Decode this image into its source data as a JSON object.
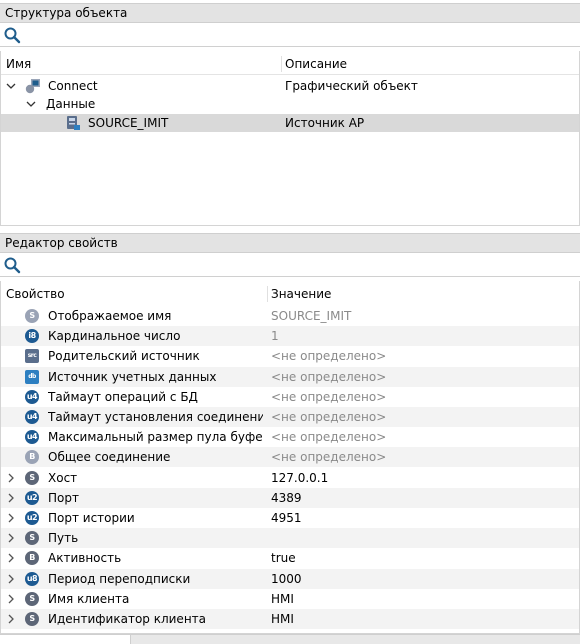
{
  "structure_panel": {
    "title": "Структура объекта",
    "search": {
      "value": "",
      "placeholder": "",
      "icon": "search-icon"
    },
    "columns": {
      "name": "Имя",
      "description": "Описание"
    },
    "tree": [
      {
        "label": "Connect",
        "description": "Графический объект",
        "icon": "graphic-object-icon",
        "expanded": true
      },
      {
        "label": "Данные",
        "description": "",
        "expanded": true
      },
      {
        "label": "SOURCE_IMIT",
        "description": "Источник АР",
        "icon": "data-source-icon",
        "selected": true
      }
    ]
  },
  "properties_panel": {
    "title": "Редактор свойств",
    "search": {
      "value": "",
      "placeholder": "",
      "icon": "search-icon"
    },
    "columns": {
      "property": "Свойство",
      "value": "Значение"
    },
    "rows": [
      {
        "badge": "S",
        "badge_color": "#9aa3b5",
        "name": "Отображаемое имя",
        "value": "SOURCE_IMIT",
        "muted": true,
        "expandable": false
      },
      {
        "badge": "i8",
        "badge_color": "#1d5a92",
        "name": "Кардинальное число",
        "value": "1",
        "muted": true,
        "expandable": false
      },
      {
        "badge": "src",
        "badge_color": "#5a6e8c",
        "name": "Родительский источник",
        "value": "<не определено>",
        "muted": true,
        "expandable": false
      },
      {
        "badge": "db",
        "badge_color": "#2d7fc1",
        "name": "Источник учетных данных",
        "value": "<не определено>",
        "muted": true,
        "expandable": false
      },
      {
        "badge": "u4",
        "badge_color": "#1d5a92",
        "name": "Таймаут операций с БД",
        "value": "<не определено>",
        "muted": true,
        "expandable": false
      },
      {
        "badge": "u4",
        "badge_color": "#1d5a92",
        "name": "Таймаут установления соединения с ...",
        "value": "<не определено>",
        "muted": true,
        "expandable": false
      },
      {
        "badge": "u4",
        "badge_color": "#1d5a92",
        "name": "Максимальный размер пула буферов",
        "value": "<не определено>",
        "muted": true,
        "expandable": false
      },
      {
        "badge": "B",
        "badge_color": "#9aa3b5",
        "name": "Общее соединение",
        "value": "<не определено>",
        "muted": true,
        "expandable": false
      },
      {
        "badge": "S",
        "badge_color": "#5d6677",
        "name": "Хост",
        "value": "127.0.0.1",
        "muted": false,
        "expandable": true
      },
      {
        "badge": "u2",
        "badge_color": "#1d5a92",
        "name": "Порт",
        "value": "4389",
        "muted": false,
        "expandable": true
      },
      {
        "badge": "u2",
        "badge_color": "#1d5a92",
        "name": "Порт истории",
        "value": "4951",
        "muted": false,
        "expandable": true
      },
      {
        "badge": "S",
        "badge_color": "#5d6677",
        "name": "Путь",
        "value": "",
        "muted": false,
        "expandable": true
      },
      {
        "badge": "B",
        "badge_color": "#5d6677",
        "name": "Активность",
        "value": "true",
        "muted": false,
        "expandable": true
      },
      {
        "badge": "u8",
        "badge_color": "#1d5a92",
        "name": "Период переподписки",
        "value": "1000",
        "muted": false,
        "expandable": true
      },
      {
        "badge": "S",
        "badge_color": "#5d6677",
        "name": "Имя клиента",
        "value": "HMI",
        "muted": false,
        "expandable": true
      },
      {
        "badge": "S",
        "badge_color": "#5d6677",
        "name": "Идентификатор клиента",
        "value": "HMI",
        "muted": false,
        "expandable": true
      }
    ]
  }
}
